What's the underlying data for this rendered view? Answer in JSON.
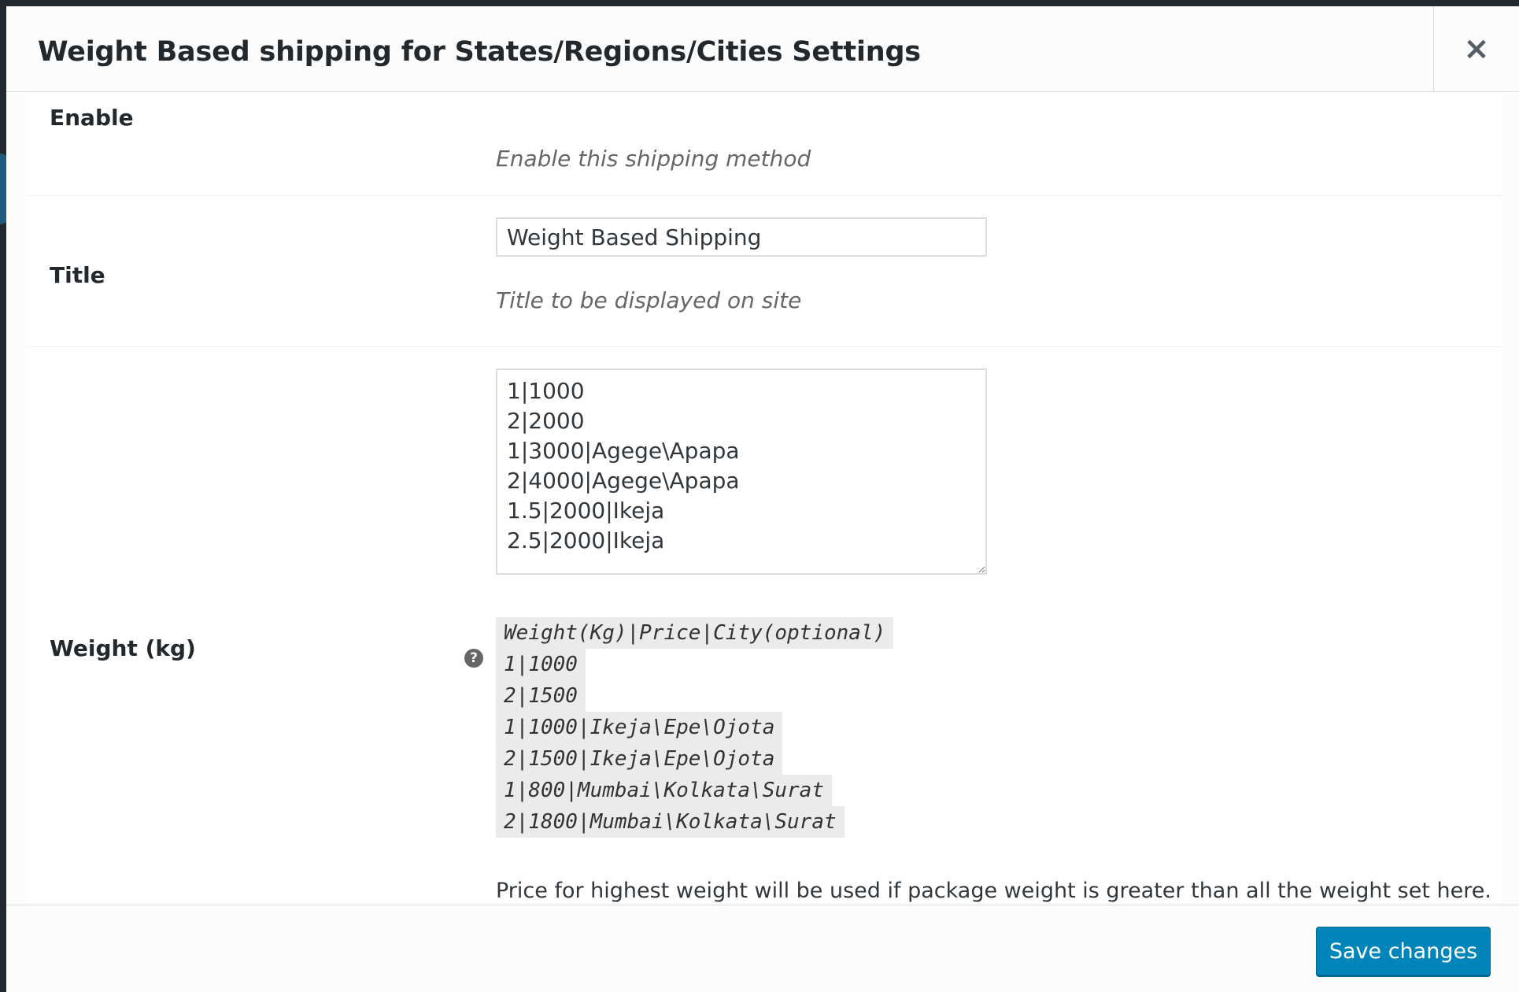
{
  "modal": {
    "title": "Weight Based shipping for States/Regions/Cities Settings",
    "close_label": "×"
  },
  "fields": {
    "enable": {
      "label": "Enable",
      "description": "Enable this shipping method"
    },
    "title": {
      "label": "Title",
      "value": "Weight Based Shipping",
      "description": "Title to be displayed on site"
    },
    "weight": {
      "label": "Weight (kg)",
      "help_icon": "help-circle-icon",
      "value": "1|1000\n2|2000\n1|3000|Agege\\Apapa\n2|4000|Agege\\Apapa\n1.5|2000|Ikeja\n2.5|2000|Ikeja",
      "format_lines": [
        "Weight(Kg)|Price|City(optional)",
        "1|1000",
        "2|1500",
        "1|1000|Ikeja\\Epe\\Ojota",
        "2|1500|Ikeja\\Epe\\Ojota",
        "1|800|Mumbai\\Kolkata\\Surat",
        "2|1800|Mumbai\\Kolkata\\Surat"
      ],
      "note": "Price for highest weight will be used if package weight is greater than all the weight set here."
    }
  },
  "footer": {
    "save_label": "Save changes"
  },
  "colors": {
    "primary_button": "#0085ba",
    "backdrop": "#23282d"
  }
}
